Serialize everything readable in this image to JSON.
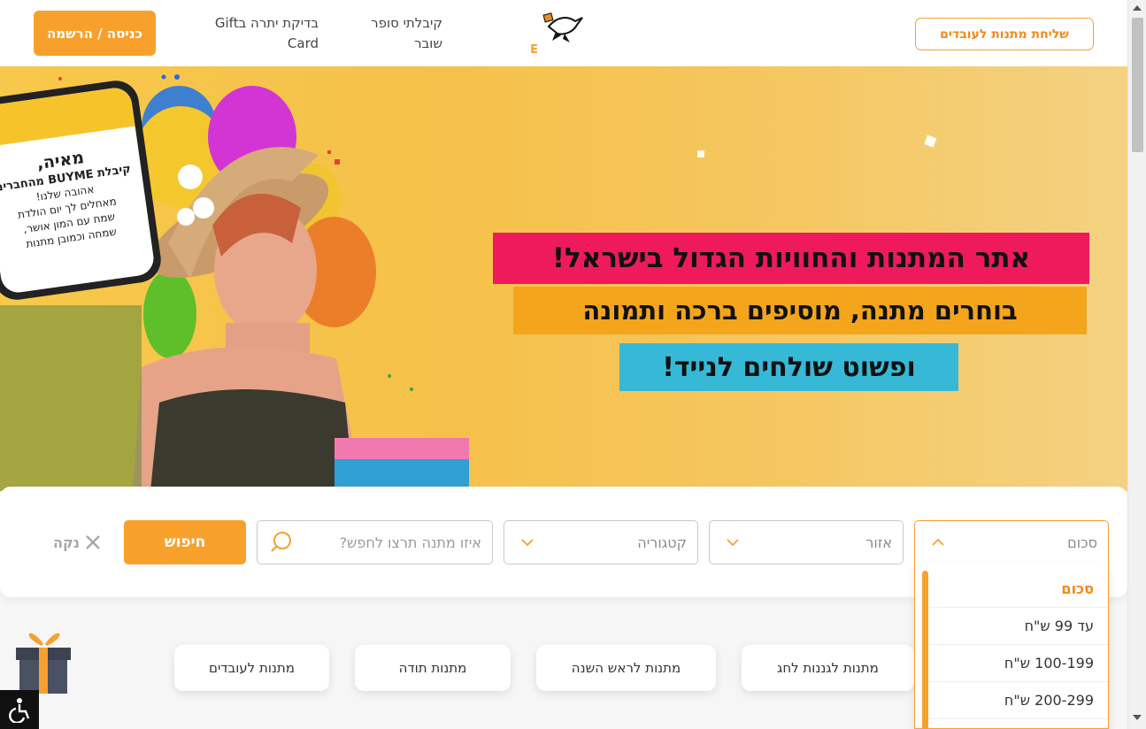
{
  "header": {
    "employee_gifts_button": "שליחת מתנות לעובדים",
    "brand": "BUYME",
    "nav_voucher_received": "קיבלתי סופר שובר",
    "nav_giftcard_balance": "בדיקת יתרה בGift Card",
    "login_button": "כניסה / הרשמה"
  },
  "hero": {
    "headline_line1": "אתר המתנות והחוויות הגדול בישראל!",
    "headline_line2": "בוחרים מתנה, מוסיפים ברכה ותמונה",
    "headline_line3": "ופשוט שולחים לנייד!",
    "phone_card": {
      "name": "מאיה,",
      "title": "קיבלת BUYME מהחברים",
      "lines": [
        "אהובה שלנו!",
        "מאחלים לך יום הולדת",
        "שמח עם המון אושר,",
        "שמחה וכמובן מתנות"
      ]
    },
    "colors": {
      "pink": "#ee1a5c",
      "orange": "#f5a51b",
      "cyan": "#35b9d6",
      "background": "#f6c14a"
    }
  },
  "search": {
    "amount_label": "סכום",
    "area_label": "אזור",
    "category_label": "קטגוריה",
    "query_placeholder": "איזו מתנה תרצו לחפש?",
    "search_button": "חיפוש",
    "clear_button": "נקה"
  },
  "amount_dropdown": {
    "options": [
      "סכום",
      "עד 99 ש\"ח",
      "100-199 ש\"ח",
      "200-299 ש\"ח"
    ],
    "selected": "סכום"
  },
  "categories": {
    "parents": "מתנות לגננות לחג",
    "new_year": "מתנות לראש השנה",
    "thanks": "מתנות תודה",
    "employees": "מתנות לעובדים"
  },
  "accent_color": "#f7a12c",
  "icons": [
    "chevron-up-icon",
    "chevron-down-icon",
    "search-icon",
    "close-icon",
    "gift-icon",
    "accessibility-icon",
    "logo-stork-icon"
  ]
}
